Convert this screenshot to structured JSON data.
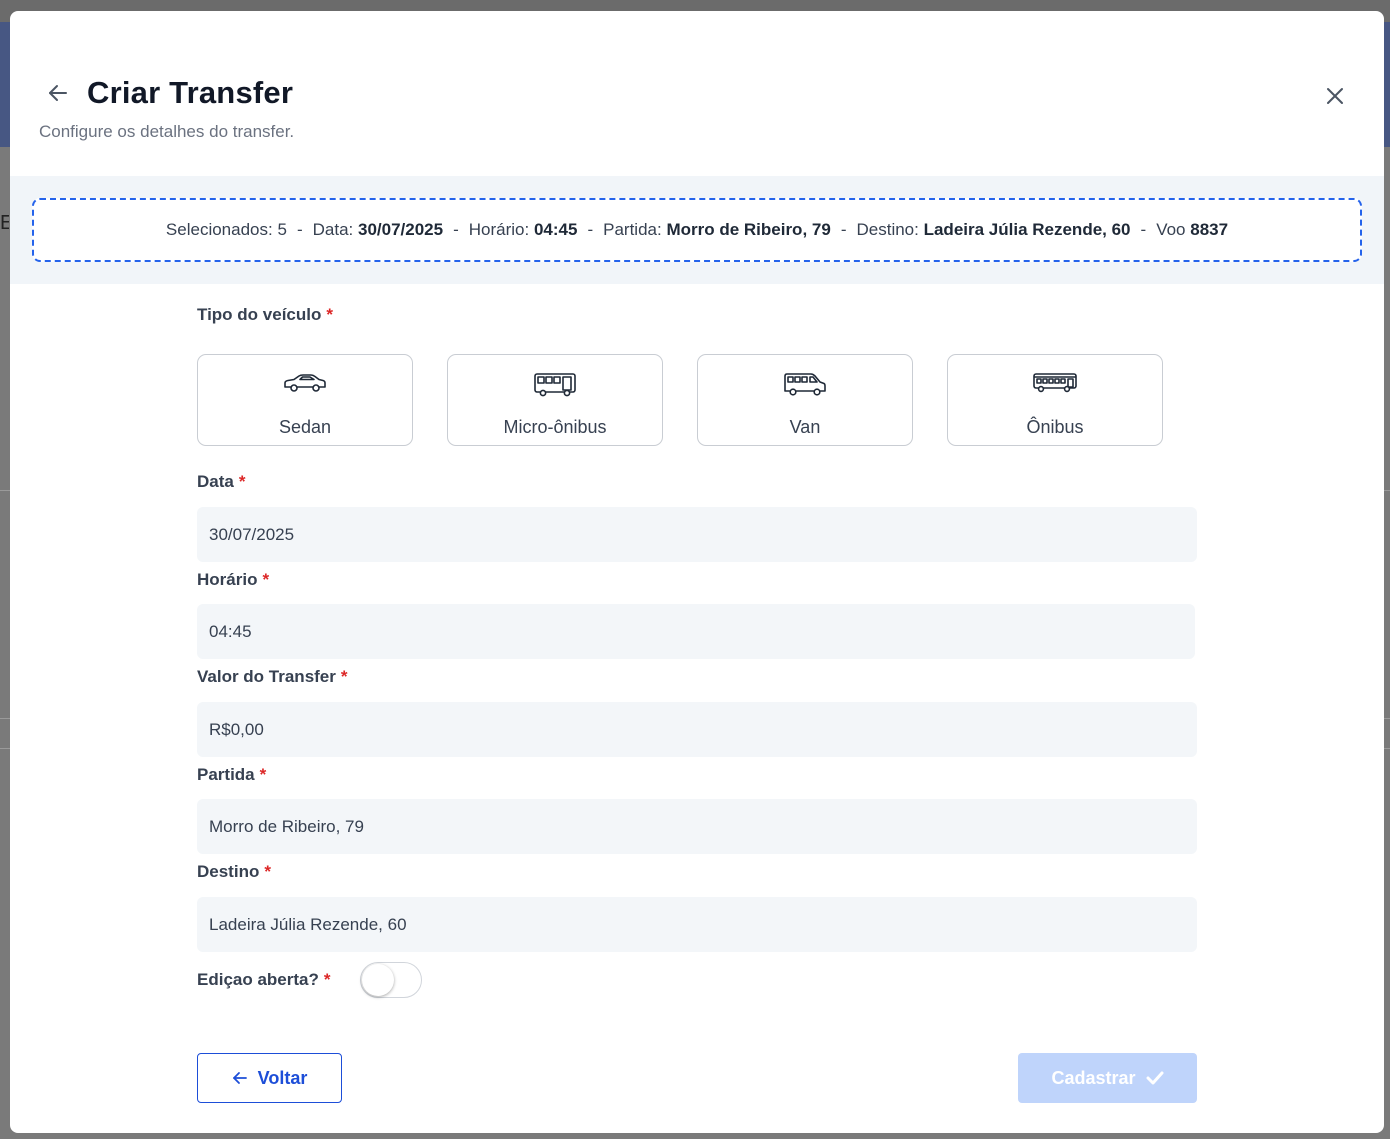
{
  "header": {
    "title": "Criar Transfer",
    "subtitle": "Configure os detalhes do transfer."
  },
  "summary": {
    "selected_label": "Selecionados:",
    "selected_count": "5",
    "date_label": "Data:",
    "date_value": "30/07/2025",
    "time_label": "Horário:",
    "time_value": "04:45",
    "departure_label": "Partida:",
    "departure_value": "Morro de Ribeiro, 79",
    "destination_label": "Destino:",
    "destination_value": "Ladeira Júlia Rezende, 60",
    "flight_label": "Voo",
    "flight_value": "8837",
    "separator": "-"
  },
  "form": {
    "vehicle_type_label": "Tipo do veículo",
    "required_mark": "*",
    "vehicles": [
      {
        "label": "Sedan",
        "icon": "sedan-icon"
      },
      {
        "label": "Micro-ônibus",
        "icon": "microbus-icon"
      },
      {
        "label": "Van",
        "icon": "van-icon"
      },
      {
        "label": "Ônibus",
        "icon": "bus-icon"
      }
    ],
    "date_label": "Data",
    "date_value": "30/07/2025",
    "time_label": "Horário",
    "time_value": "04:45",
    "price_label": "Valor do Transfer",
    "price_value": "R$0,00",
    "departure_label": "Partida",
    "departure_value": "Morro de Ribeiro, 79",
    "destination_label": "Destino",
    "destination_value": "Ladeira Júlia Rezende, 60",
    "open_edit_label": "Ediçao aberta?",
    "open_edit_enabled": false
  },
  "actions": {
    "back_label": "Voltar",
    "submit_label": "Cadastrar"
  },
  "colors": {
    "accent": "#1d4ed8",
    "summary_border": "#2563eb",
    "required": "#dc2626",
    "submit_disabled": "#bfd4fb",
    "field_bg": "#f3f6f9"
  }
}
